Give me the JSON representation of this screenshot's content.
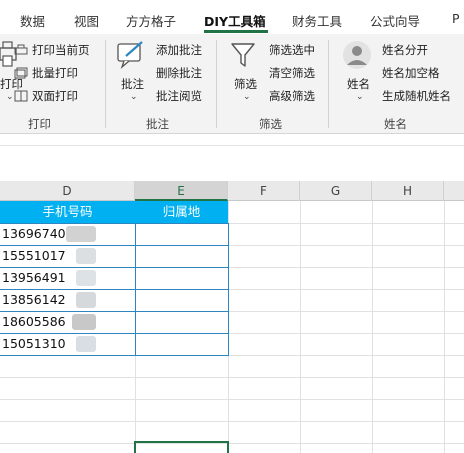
{
  "tabs": [
    {
      "label": "数据"
    },
    {
      "label": "视图"
    },
    {
      "label": "方方格子"
    },
    {
      "label": "DIY工具箱",
      "active": true
    },
    {
      "label": "财务工具"
    },
    {
      "label": "公式向导"
    },
    {
      "label": "P"
    }
  ],
  "ribbon": {
    "print_group": {
      "big_label": "打印",
      "commands": [
        "打印当前页",
        "批量打印",
        "双面打印"
      ],
      "group_label": "打印"
    },
    "comment_group": {
      "big_label": "批注",
      "commands": [
        "添加批注",
        "删除批注",
        "批注阅览"
      ],
      "group_label": "批注"
    },
    "filter_group": {
      "big_label": "筛选",
      "commands": [
        "筛选选中",
        "清空筛选",
        "高级筛选"
      ],
      "group_label": "筛选"
    },
    "name_group": {
      "big_label": "姓名",
      "commands": [
        "姓名分开",
        "姓名加空格",
        "生成随机姓名"
      ],
      "group_label": "姓名"
    }
  },
  "grid": {
    "columns": [
      "D",
      "E",
      "F",
      "G",
      "H"
    ],
    "selected_column": "E",
    "table_headers": {
      "phone": "手机号码",
      "location": "归属地"
    },
    "phones": [
      "13696740",
      "15551017",
      "13956491",
      "13856142",
      "18605586",
      "15051310"
    ]
  },
  "colors": {
    "accent": "#217346",
    "header_fill": "#00b0f0",
    "table_border": "#2e86c1"
  }
}
